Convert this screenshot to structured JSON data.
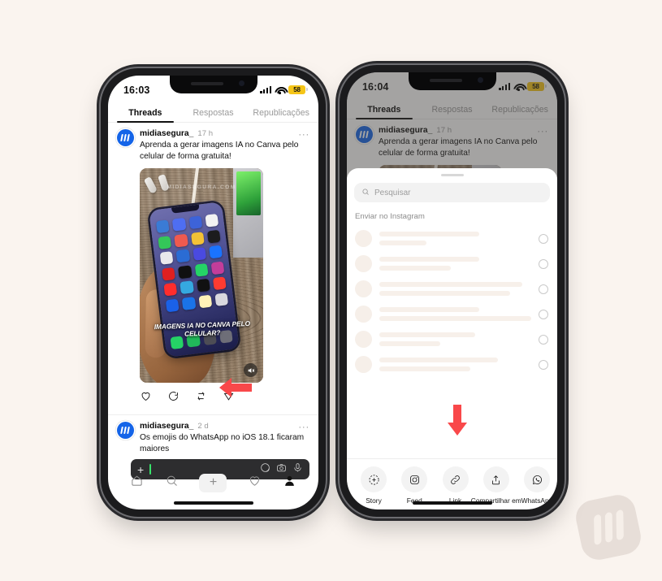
{
  "background_color": "#faf4ef",
  "accent_arrow_color": "#f9484a",
  "watermark": {
    "name": "midiasegura-logo-watermark"
  },
  "phones": {
    "left": {
      "status": {
        "time": "16:03",
        "battery": "58",
        "signal_icon": "cellular-bars-icon",
        "wifi_icon": "wifi-icon",
        "battery_icon": "battery-low-power-icon"
      },
      "tabs": [
        {
          "label": "Threads",
          "active": true
        },
        {
          "label": "Respostas",
          "active": false
        },
        {
          "label": "Republicações",
          "active": false
        }
      ],
      "posts": [
        {
          "username": "midiasegura_",
          "time": "17 h",
          "menu": "···",
          "text": "Aprenda a gerar imagens IA no Canva pelo celular de forma gratuita!",
          "media": {
            "watermark": "MIDIASEGURA.COM",
            "caption": "IMAGENS IA NO CANVA PELO CELULAR?",
            "mute_icon": "muted-speaker-icon"
          },
          "actions": [
            {
              "name": "like-icon",
              "label": "Curtir"
            },
            {
              "name": "comment-icon",
              "label": "Comentar"
            },
            {
              "name": "repost-icon",
              "label": "Republicar"
            },
            {
              "name": "share-icon",
              "label": "Compartilhar"
            }
          ]
        },
        {
          "username": "midiasegura_",
          "time": "2 d",
          "menu": "···",
          "text": "Os emojis do WhatsApp no iOS 18.1 ficaram maiores"
        }
      ],
      "composer": {
        "plus": "+",
        "value": "",
        "sticker_icon": "sticker-icon",
        "camera_icon": "camera-icon",
        "mic_icon": "microphone-icon"
      },
      "bottom_nav": [
        {
          "name": "home-icon",
          "label": "Início"
        },
        {
          "name": "search-icon",
          "label": "Pesquisar"
        },
        {
          "name": "create-plus-icon",
          "label": "+"
        },
        {
          "name": "activity-heart-icon",
          "label": "Atividade"
        },
        {
          "name": "profile-icon",
          "label": "Perfil"
        }
      ]
    },
    "right": {
      "status": {
        "time": "16:04",
        "battery": "58"
      },
      "tabs": [
        {
          "label": "Threads",
          "active": true
        },
        {
          "label": "Respostas",
          "active": false
        },
        {
          "label": "Republicações",
          "active": false
        }
      ],
      "post": {
        "username": "midiasegura_",
        "time": "17 h",
        "menu": "···",
        "text": "Aprenda a gerar imagens IA no Canva pelo celular de forma gratuita!"
      },
      "sheet": {
        "search_placeholder": "Pesquisar",
        "search_icon": "search-icon",
        "section_title": "Enviar no Instagram",
        "contacts": [
          {
            "line1_width": "66%",
            "line2_width": "31%",
            "selected": false
          },
          {
            "line1_width": "66%",
            "line2_width": "47%",
            "selected": false
          },
          {
            "line1_width": "94%",
            "line2_width": "86%",
            "selected": false
          },
          {
            "line1_width": "66%",
            "line2_width": "100%",
            "selected": false
          },
          {
            "line1_width": "63%",
            "line2_width": "40%",
            "selected": false
          },
          {
            "line1_width": "78%",
            "line2_width": "60%",
            "selected": false
          }
        ],
        "share_actions": [
          {
            "label": "Story",
            "icon": "add-to-story-icon"
          },
          {
            "label": "Feed",
            "icon": "instagram-feed-icon"
          },
          {
            "label": "Link",
            "icon": "link-chain-icon"
          },
          {
            "label": "Compartilhar em",
            "icon": "share-upload-icon"
          },
          {
            "label": "WhatsApp",
            "icon": "whatsapp-icon"
          }
        ]
      }
    }
  },
  "annotations": [
    {
      "name": "left-pointing-arrow",
      "target": "share-icon",
      "direction": "left"
    },
    {
      "name": "down-pointing-arrow",
      "target": "link-button",
      "direction": "down"
    }
  ]
}
